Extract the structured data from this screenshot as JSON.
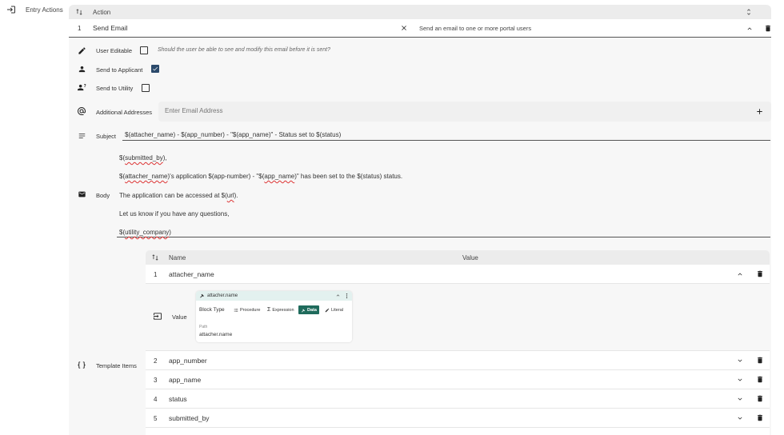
{
  "left_nav": {
    "label": "Entry Actions"
  },
  "actions_table": {
    "header": "Action",
    "row": {
      "number": "1",
      "name": "Send Email",
      "description": "Send an email to one or more portal users"
    }
  },
  "fields": {
    "user_editable": {
      "label": "User Editable",
      "hint": "Should the user be able to see and modify this email before it is sent?",
      "checked": false
    },
    "send_to_applicant": {
      "label": "Send to Applicant",
      "checked": true
    },
    "send_to_utility": {
      "label": "Send to Utility",
      "checked": false
    },
    "additional_addresses": {
      "label": "Additional Addresses",
      "placeholder": "Enter Email Address"
    },
    "subject": {
      "label": "Subject",
      "value": "$(attacher_name) - $(app_number) - \"$(app_name)\" - Status set to $(status)"
    },
    "body": {
      "label": "Body",
      "lines": [
        {
          "a": "$(",
          "b": "submitted_by",
          "c": "),"
        },
        {
          "a": "$(",
          "b": "attacher_name",
          "c": ")'s application $(app-number) - \"$(",
          "d": "app_name",
          "e": ")\" has been set to the $(status) status."
        },
        {
          "a": "The application can be accessed at $(",
          "b": "url",
          "c": ")."
        },
        {
          "a": "Let us know if you have any questions,"
        },
        {
          "a": "$(",
          "b": "utility_company",
          "c": ")"
        }
      ]
    }
  },
  "template_items": {
    "label": "Template Items",
    "col_name": "Name",
    "col_value": "Value",
    "items": [
      {
        "num": "1",
        "name": "attacher_name"
      },
      {
        "num": "2",
        "name": "app_number"
      },
      {
        "num": "3",
        "name": "app_name"
      },
      {
        "num": "4",
        "name": "status"
      },
      {
        "num": "5",
        "name": "submitted_by"
      }
    ],
    "expanded": {
      "value_label": "Value",
      "card_title": "attacher.name",
      "block_type_label": "Block Type",
      "types": [
        "Procedure",
        "Expression",
        "Data",
        "Literal"
      ],
      "active_type": "Data",
      "path_label": "Path",
      "path_value": "attacher.name"
    }
  },
  "colors": {
    "accent": "#1f6b5c",
    "checkbox": "#2b4a6b",
    "card_header": "#e3f1ef",
    "table_header": "#f0f0f0"
  }
}
